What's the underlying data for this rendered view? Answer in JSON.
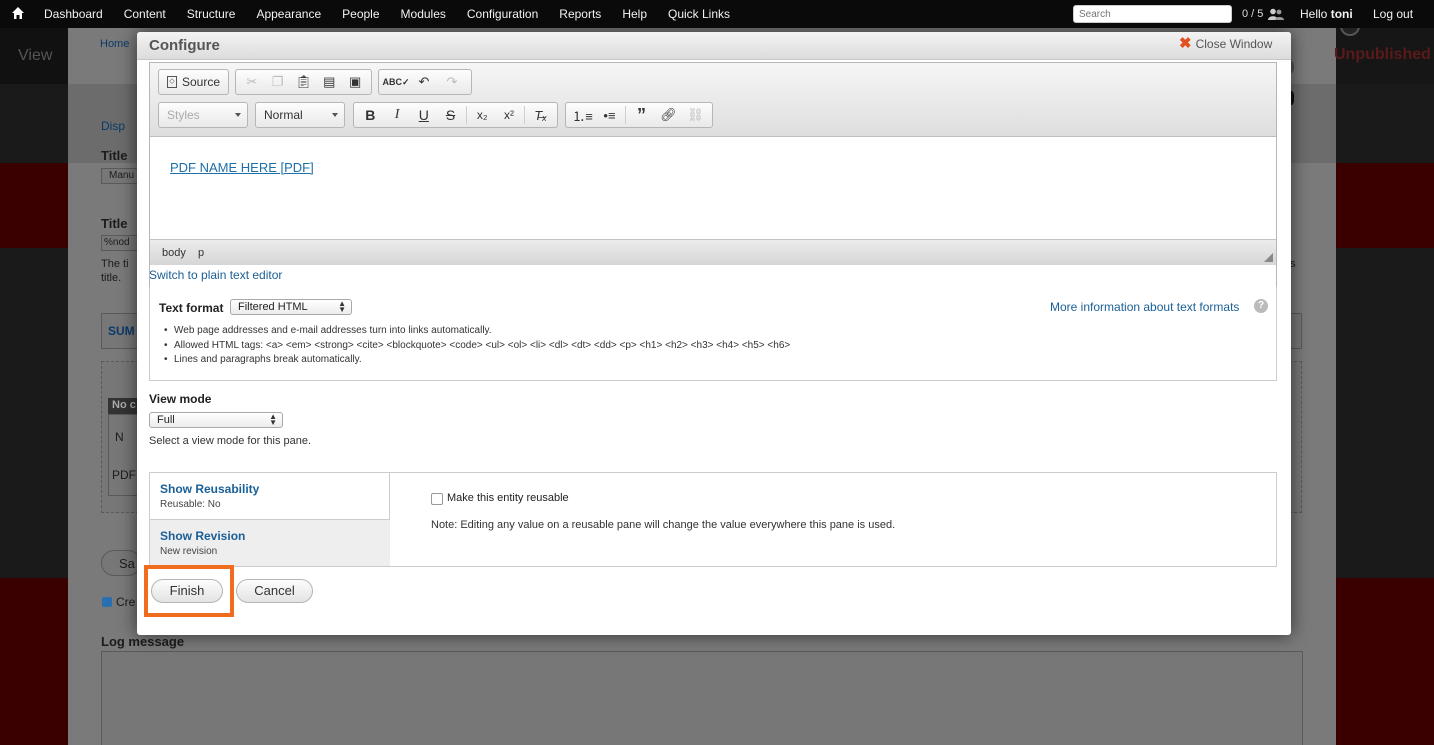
{
  "toolbar": {
    "menu": [
      "Dashboard",
      "Content",
      "Structure",
      "Appearance",
      "People",
      "Modules",
      "Configuration",
      "Reports",
      "Help",
      "Quick Links"
    ],
    "search_placeholder": "Search",
    "counter": "0 / 5",
    "hello_prefix": "Hello",
    "username": "toni",
    "logout": "Log out"
  },
  "modal": {
    "title": "Configure",
    "close_label": "Close Window"
  },
  "editor": {
    "source_label": "Source",
    "styles_combo": "Styles",
    "format_combo": "Normal",
    "content_link": "PDF NAME HERE [PDF]",
    "path": [
      "body",
      "p"
    ],
    "switch_plain": "Switch to plain text editor"
  },
  "text_format": {
    "label": "Text format",
    "selected": "Filtered HTML",
    "more_info": "More information about text formats",
    "tips": [
      "Web page addresses and e-mail addresses turn into links automatically.",
      "Allowed HTML tags: <a> <em> <strong> <cite> <blockquote> <code> <ul> <ol> <li> <dl> <dt> <dd> <p> <h1> <h2> <h3> <h4> <h5> <h6>",
      "Lines and paragraphs break automatically."
    ]
  },
  "view_mode": {
    "label": "View mode",
    "selected": "Full",
    "description": "Select a view mode for this pane."
  },
  "vertical_tabs": {
    "tabs": [
      {
        "title": "Show Reusability",
        "summary": "Reusable: No"
      },
      {
        "title": "Show Revision",
        "summary": "New revision"
      }
    ],
    "reuse_checkbox_label": "Make this entity reusable",
    "reuse_note": "Note: Editing any value on a reusable pane will change the value everywhere this pane is used."
  },
  "actions": {
    "finish": "Finish",
    "cancel": "Cancel"
  },
  "background": {
    "breadcrumb": "Home",
    "view_tab": "View",
    "unpublished": "Unpublished",
    "disp": "Disp",
    "title_1": "Title",
    "manu": "Manu",
    "title_2": "Title",
    "nod": "%nod",
    "the_ti": "The ti",
    "title_word": "title.",
    "s_suffix": "s",
    "sum": "SUM",
    "no_c": "No c",
    "n_letter": "N",
    "pdf": "PDF",
    "save": "Sa",
    "cre": "Cre",
    "log_message": "Log message"
  },
  "colors": {
    "highlight": "#f06c1e",
    "link": "#1a5f96",
    "toolbar_bg": "#0a0a0a"
  }
}
